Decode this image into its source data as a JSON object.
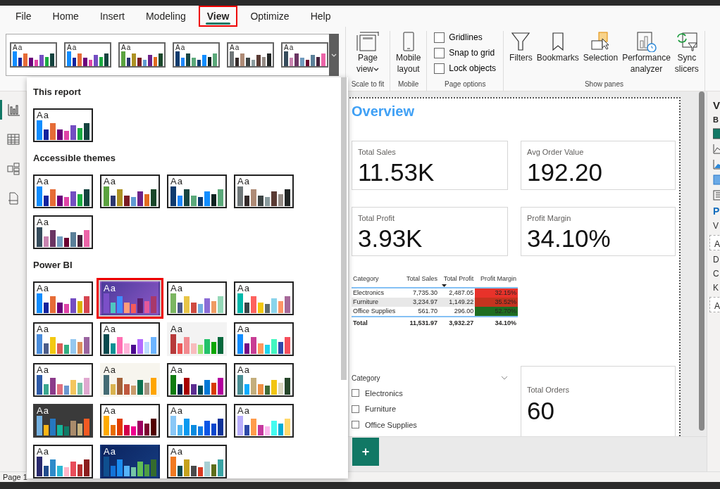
{
  "tabs": [
    {
      "label": "File",
      "selected": false,
      "highlighted": false
    },
    {
      "label": "Home",
      "selected": false,
      "highlighted": false
    },
    {
      "label": "Insert",
      "selected": false,
      "highlighted": false
    },
    {
      "label": "Modeling",
      "selected": false,
      "highlighted": false
    },
    {
      "label": "View",
      "selected": true,
      "highlighted": true
    },
    {
      "label": "Optimize",
      "selected": false,
      "highlighted": false
    },
    {
      "label": "Help",
      "selected": false,
      "highlighted": false
    }
  ],
  "ribbon": {
    "themes_gallery": [
      {
        "sample": "Aa",
        "kind": "white",
        "bars": [
          {
            "color": "#118dff"
          },
          {
            "color": "#12239e"
          },
          {
            "color": "#e66c37"
          },
          {
            "color": "#6b007b"
          },
          {
            "color": "#e044a7"
          },
          {
            "color": "#744ec2"
          },
          {
            "color": "#1aab40"
          },
          {
            "color": "#15433f"
          }
        ]
      },
      {
        "sample": "Aa",
        "kind": "white",
        "bars": [
          {
            "color": "#118dff"
          },
          {
            "color": "#12239e"
          },
          {
            "color": "#e66c37"
          },
          {
            "color": "#6b007b"
          },
          {
            "color": "#e044a7"
          },
          {
            "color": "#744ec2"
          },
          {
            "color": "#1aab40"
          },
          {
            "color": "#15433f"
          }
        ]
      },
      {
        "sample": "Aa",
        "kind": "white",
        "bars": [
          {
            "color": "#5ba33f"
          },
          {
            "color": "#2c3770"
          },
          {
            "color": "#ad9224"
          },
          {
            "color": "#7a1c24"
          },
          {
            "color": "#609bd3"
          },
          {
            "color": "#6c228a"
          },
          {
            "color": "#e26c20"
          },
          {
            "color": "#19472a"
          }
        ]
      },
      {
        "sample": "Aa",
        "kind": "white",
        "bars": [
          {
            "color": "#0f3b6e"
          },
          {
            "color": "#1e87fa"
          },
          {
            "color": "#194540"
          },
          {
            "color": "#5ba97a"
          },
          {
            "color": "#0f3b6e"
          },
          {
            "color": "#118dff"
          },
          {
            "color": "#0c2220"
          },
          {
            "color": "#5ba97a"
          }
        ]
      },
      {
        "sample": "Aa",
        "kind": "white",
        "bars": [
          {
            "color": "#6f7779"
          },
          {
            "color": "#342a2a"
          },
          {
            "color": "#ae8b76"
          },
          {
            "color": "#3d4444"
          },
          {
            "color": "#8b9c9f"
          },
          {
            "color": "#5a3b34"
          },
          {
            "color": "#958c86"
          },
          {
            "color": "#222626"
          }
        ]
      },
      {
        "sample": "Aa",
        "kind": "white",
        "bars": [
          {
            "color": "#364c5c"
          },
          {
            "color": "#c984b0"
          },
          {
            "color": "#6b3563"
          },
          {
            "color": "#6f9abd"
          },
          {
            "color": "#6a0030"
          },
          {
            "color": "#5b8099"
          },
          {
            "color": "#45213c"
          },
          {
            "color": "#ec64a8"
          }
        ]
      }
    ],
    "groups": [
      {
        "label": "Scale to fit",
        "items": [
          {
            "kind": "button",
            "label": "Page view",
            "dropdown": true
          }
        ]
      },
      {
        "label": "Mobile",
        "items": [
          {
            "kind": "button",
            "label": "Mobile layout",
            "dropdown": false
          }
        ]
      },
      {
        "label": "Page options",
        "items": [
          {
            "kind": "checkbox",
            "label": "Gridlines",
            "checked": false
          },
          {
            "kind": "checkbox",
            "label": "Snap to grid",
            "checked": false
          },
          {
            "kind": "checkbox",
            "label": "Lock objects",
            "checked": false
          }
        ]
      },
      {
        "label": "Show panes",
        "items": [
          {
            "kind": "button",
            "label": "Filters",
            "dropdown": false
          },
          {
            "kind": "button",
            "label": "Bookmarks",
            "dropdown": false
          },
          {
            "kind": "button",
            "label": "Selection",
            "dropdown": false
          },
          {
            "kind": "button",
            "label": "Performance analyzer",
            "dropdown": false
          },
          {
            "kind": "button",
            "label": "Sync slicers",
            "dropdown": false
          }
        ]
      }
    ]
  },
  "themes_dropdown": [
    {
      "title": "This report",
      "themes": [
        {
          "sample": "Aa",
          "kind": "white",
          "selected": false,
          "bars": [
            {
              "color": "#118dff"
            },
            {
              "color": "#12239e"
            },
            {
              "color": "#e66c37"
            },
            {
              "color": "#6b007b"
            },
            {
              "color": "#e044a7"
            },
            {
              "color": "#744ec2"
            },
            {
              "color": "#1aab40"
            },
            {
              "color": "#15433f"
            }
          ]
        }
      ]
    },
    {
      "title": "Accessible themes",
      "themes": [
        {
          "sample": "Aa",
          "kind": "white",
          "selected": false,
          "bars": [
            {
              "color": "#118dff"
            },
            {
              "color": "#12239e"
            },
            {
              "color": "#e66c37"
            },
            {
              "color": "#6b007b"
            },
            {
              "color": "#e044a7"
            },
            {
              "color": "#744ec2"
            },
            {
              "color": "#1aab40"
            },
            {
              "color": "#15433f"
            }
          ]
        },
        {
          "sample": "Aa",
          "kind": "white",
          "selected": false,
          "bars": [
            {
              "color": "#5ba33f"
            },
            {
              "color": "#2c3770"
            },
            {
              "color": "#ad9224"
            },
            {
              "color": "#7a1c24"
            },
            {
              "color": "#609bd3"
            },
            {
              "color": "#6c228a"
            },
            {
              "color": "#e26c20"
            },
            {
              "color": "#19472a"
            }
          ]
        },
        {
          "sample": "Aa",
          "kind": "white",
          "selected": false,
          "bars": [
            {
              "color": "#0f3b6e"
            },
            {
              "color": "#1e87fa"
            },
            {
              "color": "#194540"
            },
            {
              "color": "#5ba97a"
            },
            {
              "color": "#0f3b6e"
            },
            {
              "color": "#118dff"
            },
            {
              "color": "#0c2220"
            },
            {
              "color": "#5ba97a"
            }
          ]
        },
        {
          "sample": "Aa",
          "kind": "white",
          "selected": false,
          "bars": [
            {
              "color": "#6f7779"
            },
            {
              "color": "#342a2a"
            },
            {
              "color": "#ae8b76"
            },
            {
              "color": "#3d4444"
            },
            {
              "color": "#8b9c9f"
            },
            {
              "color": "#5a3b34"
            },
            {
              "color": "#958c86"
            },
            {
              "color": "#222626"
            }
          ]
        },
        {
          "sample": "Aa",
          "kind": "white",
          "selected": false,
          "bars": [
            {
              "color": "#364c5c"
            },
            {
              "color": "#c984b0"
            },
            {
              "color": "#6b3563"
            },
            {
              "color": "#6f9abd"
            },
            {
              "color": "#6a0030"
            },
            {
              "color": "#5b8099"
            },
            {
              "color": "#45213c"
            },
            {
              "color": "#ec64a8"
            }
          ]
        }
      ]
    },
    {
      "title": "Power BI",
      "themes": [
        {
          "sample": "Aa",
          "kind": "white",
          "selected": false,
          "bars": [
            {
              "color": "#118dff"
            },
            {
              "color": "#12239e"
            },
            {
              "color": "#e66c37"
            },
            {
              "color": "#6b007b"
            },
            {
              "color": "#e044a7"
            },
            {
              "color": "#744ec2"
            },
            {
              "color": "#d9b300"
            },
            {
              "color": "#d64550"
            }
          ]
        },
        {
          "sample": "Aa",
          "kind": "purple",
          "selected": true,
          "bars": [
            {
              "color": "#7b4fc8"
            },
            {
              "color": "#4ec6c0"
            },
            {
              "color": "#3f8cff"
            },
            {
              "color": "#ff9c7a"
            },
            {
              "color": "#f45a5a"
            },
            {
              "color": "#5b1e6e"
            },
            {
              "color": "#e4589a"
            },
            {
              "color": "#a8386a"
            }
          ]
        },
        {
          "sample": "Aa",
          "kind": "white",
          "selected": false,
          "bars": [
            {
              "color": "#7bb661"
            },
            {
              "color": "#4e5a8a"
            },
            {
              "color": "#e8c547"
            },
            {
              "color": "#cf4b41"
            },
            {
              "color": "#73aee0"
            },
            {
              "color": "#8b6cd6"
            },
            {
              "color": "#ef9b62"
            },
            {
              "color": "#95d8b8"
            }
          ]
        },
        {
          "sample": "Aa",
          "kind": "white",
          "selected": false,
          "bars": [
            {
              "color": "#01b8aa"
            },
            {
              "color": "#374649"
            },
            {
              "color": "#fd625e"
            },
            {
              "color": "#f2c80f"
            },
            {
              "color": "#5f6b6d"
            },
            {
              "color": "#8ad4eb"
            },
            {
              "color": "#fe9666"
            },
            {
              "color": "#a66999"
            }
          ]
        },
        {
          "sample": "Aa",
          "kind": "white",
          "selected": false,
          "bars": [
            {
              "color": "#4a8ddc"
            },
            {
              "color": "#4c5d8a"
            },
            {
              "color": "#f3c911"
            },
            {
              "color": "#dc5b57"
            },
            {
              "color": "#33ae81"
            },
            {
              "color": "#95c8f0"
            },
            {
              "color": "#dd915f"
            },
            {
              "color": "#9a64a0"
            }
          ]
        },
        {
          "sample": "Aa",
          "kind": "white",
          "selected": false,
          "bars": [
            {
              "color": "#0a4a4e"
            },
            {
              "color": "#0e9094"
            },
            {
              "color": "#ff6fb3"
            },
            {
              "color": "#ffb4d9"
            },
            {
              "color": "#4b0a8f"
            },
            {
              "color": "#b36bff"
            },
            {
              "color": "#bcdcff"
            },
            {
              "color": "#6cb4ff"
            }
          ]
        },
        {
          "sample": "Aa",
          "kind": "grey",
          "selected": false,
          "bars": [
            {
              "color": "#b73a3a"
            },
            {
              "color": "#ec5656"
            },
            {
              "color": "#f28a90"
            },
            {
              "color": "#f8bcbd"
            },
            {
              "color": "#99e472"
            },
            {
              "color": "#23c26b"
            },
            {
              "color": "#0ba700"
            },
            {
              "color": "#06683c"
            }
          ]
        },
        {
          "sample": "Aa",
          "kind": "white",
          "selected": false,
          "bars": [
            {
              "color": "#118dff"
            },
            {
              "color": "#750985"
            },
            {
              "color": "#c83d95"
            },
            {
              "color": "#ff985e"
            },
            {
              "color": "#1dd5ee"
            },
            {
              "color": "#42f7c0"
            },
            {
              "color": "#3049ad"
            },
            {
              "color": "#f64f5c"
            }
          ]
        },
        {
          "sample": "Aa",
          "kind": "white",
          "selected": false,
          "bars": [
            {
              "color": "#2e5ba8"
            },
            {
              "color": "#3aa78f"
            },
            {
              "color": "#8c3b8a"
            },
            {
              "color": "#e0707e"
            },
            {
              "color": "#6b97d0"
            },
            {
              "color": "#f4c65f"
            },
            {
              "color": "#7dc4a8"
            },
            {
              "color": "#e0a8d0"
            }
          ]
        },
        {
          "sample": "Aa",
          "kind": "cream",
          "selected": false,
          "bars": [
            {
              "color": "#456c74"
            },
            {
              "color": "#d9b34f"
            },
            {
              "color": "#a36238"
            },
            {
              "color": "#c0593f"
            },
            {
              "color": "#c99c6b"
            },
            {
              "color": "#0c7151"
            },
            {
              "color": "#a59483"
            },
            {
              "color": "#ffa500"
            }
          ]
        },
        {
          "sample": "Aa",
          "kind": "white",
          "selected": false,
          "bars": [
            {
              "color": "#107c10"
            },
            {
              "color": "#002050"
            },
            {
              "color": "#a80000"
            },
            {
              "color": "#5c2d91"
            },
            {
              "color": "#004b50"
            },
            {
              "color": "#0078d7"
            },
            {
              "color": "#d83b01"
            },
            {
              "color": "#b4009e"
            }
          ]
        },
        {
          "sample": "Aa",
          "kind": "white",
          "selected": false,
          "bars": [
            {
              "color": "#4a8f94"
            },
            {
              "color": "#0bacff"
            },
            {
              "color": "#c4ae7c"
            },
            {
              "color": "#ef8f44"
            },
            {
              "color": "#3f6b37"
            },
            {
              "color": "#f2c511"
            },
            {
              "color": "#dad7c0"
            },
            {
              "color": "#26462a"
            }
          ]
        },
        {
          "sample": "Aa",
          "kind": "dark",
          "selected": false,
          "bars": [
            {
              "color": "#73b0e0"
            },
            {
              "color": "#fdb515"
            },
            {
              "color": "#2677c0"
            },
            {
              "color": "#16b59a"
            },
            {
              "color": "#0f7a66"
            },
            {
              "color": "#a98b6b"
            },
            {
              "color": "#c7b27e"
            },
            {
              "color": "#f25a23"
            }
          ]
        },
        {
          "sample": "Aa",
          "kind": "white",
          "selected": false,
          "bars": [
            {
              "color": "#ffaa00"
            },
            {
              "color": "#e86c00"
            },
            {
              "color": "#e03c00"
            },
            {
              "color": "#d1004b"
            },
            {
              "color": "#ef008f"
            },
            {
              "color": "#9e0062"
            },
            {
              "color": "#7b0030"
            },
            {
              "color": "#520000"
            }
          ]
        },
        {
          "sample": "Aa",
          "kind": "white",
          "selected": false,
          "bars": [
            {
              "color": "#8ac8f7"
            },
            {
              "color": "#4cb4f0"
            },
            {
              "color": "#0b9af0"
            },
            {
              "color": "#0a8bdf"
            },
            {
              "color": "#0c7be6"
            },
            {
              "color": "#0a55e6"
            },
            {
              "color": "#0a47cc"
            },
            {
              "color": "#0f3399"
            }
          ]
        },
        {
          "sample": "Aa",
          "kind": "white",
          "selected": false,
          "bars": [
            {
              "color": "#b9aefc"
            },
            {
              "color": "#2e49a8"
            },
            {
              "color": "#ff9c4b"
            },
            {
              "color": "#c4399f"
            },
            {
              "color": "#fcb8ee"
            },
            {
              "color": "#42fbf0"
            },
            {
              "color": "#00add6"
            },
            {
              "color": "#ffd86b"
            }
          ]
        },
        {
          "sample": "Aa",
          "kind": "white",
          "selected": false,
          "bars": [
            {
              "color": "#2a2a6e"
            },
            {
              "color": "#214c8c"
            },
            {
              "color": "#2e8bc9"
            },
            {
              "color": "#2bb8d4"
            },
            {
              "color": "#ffb6c8"
            },
            {
              "color": "#e84d5a"
            },
            {
              "color": "#b5302f"
            },
            {
              "color": "#8b1e1e"
            }
          ]
        },
        {
          "sample": "Aa",
          "kind": "navy",
          "selected": false,
          "bars": [
            {
              "color": "#0f4f8f"
            },
            {
              "color": "#1373d8"
            },
            {
              "color": "#1a8cef"
            },
            {
              "color": "#56b4f9"
            },
            {
              "color": "#75c5a6"
            },
            {
              "color": "#60be55"
            },
            {
              "color": "#4e9e44"
            },
            {
              "color": "#356b2e"
            }
          ]
        },
        {
          "sample": "Aa",
          "kind": "white",
          "selected": false,
          "bars": [
            {
              "color": "#f07a22"
            },
            {
              "color": "#0a4a50"
            },
            {
              "color": "#c6a21c"
            },
            {
              "color": "#4a4a4a"
            },
            {
              "color": "#d83a22"
            },
            {
              "color": "#a8cfd4"
            },
            {
              "color": "#5e6e1a"
            },
            {
              "color": "#3aa4a4"
            }
          ]
        }
      ]
    }
  ],
  "report": {
    "title": "Overview",
    "cards": [
      {
        "label": "Total Sales",
        "value": "11.53K"
      },
      {
        "label": "Avg Order Value",
        "value": "192.20"
      },
      {
        "label": "Total Profit",
        "value": "3.93K"
      },
      {
        "label": "Profit Margin",
        "value": "34.10%"
      }
    ],
    "table": {
      "columns": [
        {
          "label": "Category",
          "sorted": false
        },
        {
          "label": "Total Sales",
          "sorted": false
        },
        {
          "label": "Total Profit",
          "sorted": true
        },
        {
          "label": "Profit Margin",
          "sorted": false
        }
      ],
      "rows": [
        {
          "cells": [
            "Electronics",
            "7,735.30",
            "2,487.05",
            "32.15%"
          ],
          "color": "#e8322a"
        },
        {
          "cells": [
            "Furniture",
            "3,234.97",
            "1,149.22",
            "35.52%"
          ],
          "color": "#c4331f"
        },
        {
          "cells": [
            "Office Supplies",
            "561.70",
            "296.00",
            "52.70%"
          ],
          "color": "#1e6e22"
        }
      ],
      "total": [
        "Total",
        "11,531.97",
        "3,932.27",
        "34.10%"
      ]
    },
    "slicer": {
      "title": "Category",
      "items": [
        {
          "label": "Electronics",
          "checked": false
        },
        {
          "label": "Furniture",
          "checked": false
        },
        {
          "label": "Office Supplies",
          "checked": false
        }
      ]
    },
    "orders_card": {
      "label": "Total Orders",
      "value": "60"
    }
  },
  "add_page": "+",
  "status_bar": "Page 1",
  "right_pane": {
    "title": "V",
    "subtitle": "B",
    "section": "P",
    "section_2": "V",
    "fields": [
      "A",
      "A"
    ],
    "labels": [
      "D",
      "C",
      "K"
    ]
  }
}
